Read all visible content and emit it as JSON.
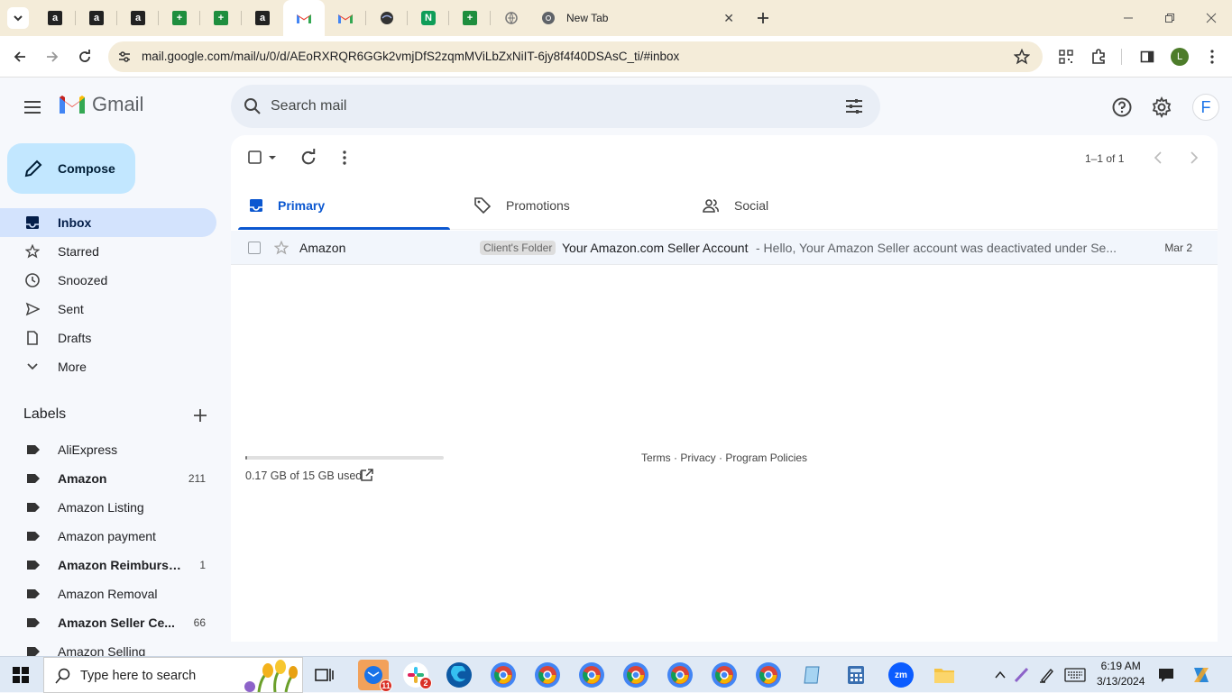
{
  "browser": {
    "new_tab_title": "New Tab",
    "url": "mail.google.com/mail/u/0/d/AEoRXRQR6GGk2vmjDfS2zqmMViLbZxNiIT-6jy8f4f40DSAsC_ti/#inbox",
    "profile_initial": "L",
    "pinned_tabs": [
      "amazon-icon",
      "amazon-icon",
      "amazon-icon",
      "sheets-icon",
      "sheets-icon",
      "amazon-icon",
      "gmail-icon",
      "gmail-icon",
      "globe-icon",
      "green-app-icon",
      "sheets-icon",
      "globe-icon"
    ]
  },
  "gmail": {
    "brand": "Gmail",
    "search_placeholder": "Search mail",
    "account_initial": "F",
    "compose_label": "Compose",
    "nav": [
      {
        "label": "Inbox",
        "icon": "inbox-icon",
        "selected": true
      },
      {
        "label": "Starred",
        "icon": "star-icon"
      },
      {
        "label": "Snoozed",
        "icon": "clock-icon"
      },
      {
        "label": "Sent",
        "icon": "send-icon"
      },
      {
        "label": "Drafts",
        "icon": "draft-icon"
      },
      {
        "label": "More",
        "icon": "chevron-down-icon"
      }
    ],
    "labels_title": "Labels",
    "labels": [
      {
        "name": "AliExpress",
        "count": "",
        "bold": false
      },
      {
        "name": "Amazon",
        "count": "211",
        "bold": true
      },
      {
        "name": "Amazon Listing",
        "count": "",
        "bold": false
      },
      {
        "name": "Amazon payment",
        "count": "",
        "bold": false
      },
      {
        "name": "Amazon Reimburse...",
        "count": "1",
        "bold": true
      },
      {
        "name": "Amazon Removal",
        "count": "",
        "bold": false
      },
      {
        "name": "Amazon Seller Ce...",
        "count": "66",
        "bold": true
      },
      {
        "name": "Amazon Selling",
        "count": "",
        "bold": false
      }
    ],
    "pager": "1–1 of 1",
    "tabs": [
      "Primary",
      "Promotions",
      "Social"
    ],
    "email": {
      "sender": "Amazon",
      "label_chip": "Client's Folder",
      "subject": "Your Amazon.com Seller Account",
      "snippet": " - Hello, Your Amazon Seller account was deactivated under Se...",
      "date": "Mar 2"
    },
    "storage": {
      "text": "0.17 GB of 15 GB used",
      "fraction": 0.011
    },
    "footer": {
      "terms": "Terms",
      "sep": " · ",
      "privacy": "Privacy",
      "policies": "Program Policies"
    }
  },
  "taskbar": {
    "search_placeholder": "Type here to search",
    "time": "6:19 AM",
    "date": "3/13/2024",
    "badges": {
      "mail": "11",
      "slack": "2"
    }
  },
  "colors": {
    "accent": "#0b57d0",
    "compose": "#c2e7ff",
    "selected": "#d3e3fd",
    "tabstrip": "#f4ecd9"
  }
}
